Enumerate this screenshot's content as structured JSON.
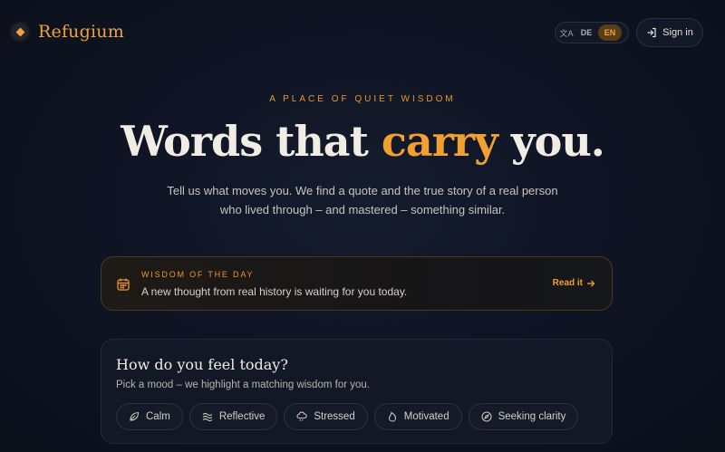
{
  "brand": {
    "name": "Refugium",
    "icon": "diamond-logo-icon"
  },
  "language": {
    "icon": "translate-icon",
    "options": [
      "DE",
      "EN"
    ],
    "selected": "EN"
  },
  "auth": {
    "signin_label": "Sign in",
    "icon": "sign-in-icon"
  },
  "hero": {
    "eyebrow": "A PLACE OF QUIET WISDOM",
    "headline_before": "Words that ",
    "headline_accent": "carry",
    "headline_after": " you.",
    "subtitle_line1": "Tell us what moves you. We find a quote and the true story of a real person",
    "subtitle_line2": "who lived through – and mastered – something similar."
  },
  "wisdom_of_day": {
    "kicker": "WISDOM OF THE DAY",
    "text": "A new thought from real history is waiting for you today.",
    "link_label": "Read it",
    "icon": "calendar-icon"
  },
  "mood": {
    "title": "How do you feel today?",
    "subtitle": "Pick a mood – we highlight a matching wisdom for you.",
    "chips": [
      {
        "label": "Calm",
        "icon": "leaf-icon"
      },
      {
        "label": "Reflective",
        "icon": "waves-icon"
      },
      {
        "label": "Stressed",
        "icon": "cloud-rain-icon"
      },
      {
        "label": "Motivated",
        "icon": "flame-icon"
      },
      {
        "label": "Seeking clarity",
        "icon": "compass-icon"
      }
    ]
  },
  "colors": {
    "accent": "#f0a030",
    "background": "#0f1524",
    "card": "#121826"
  }
}
